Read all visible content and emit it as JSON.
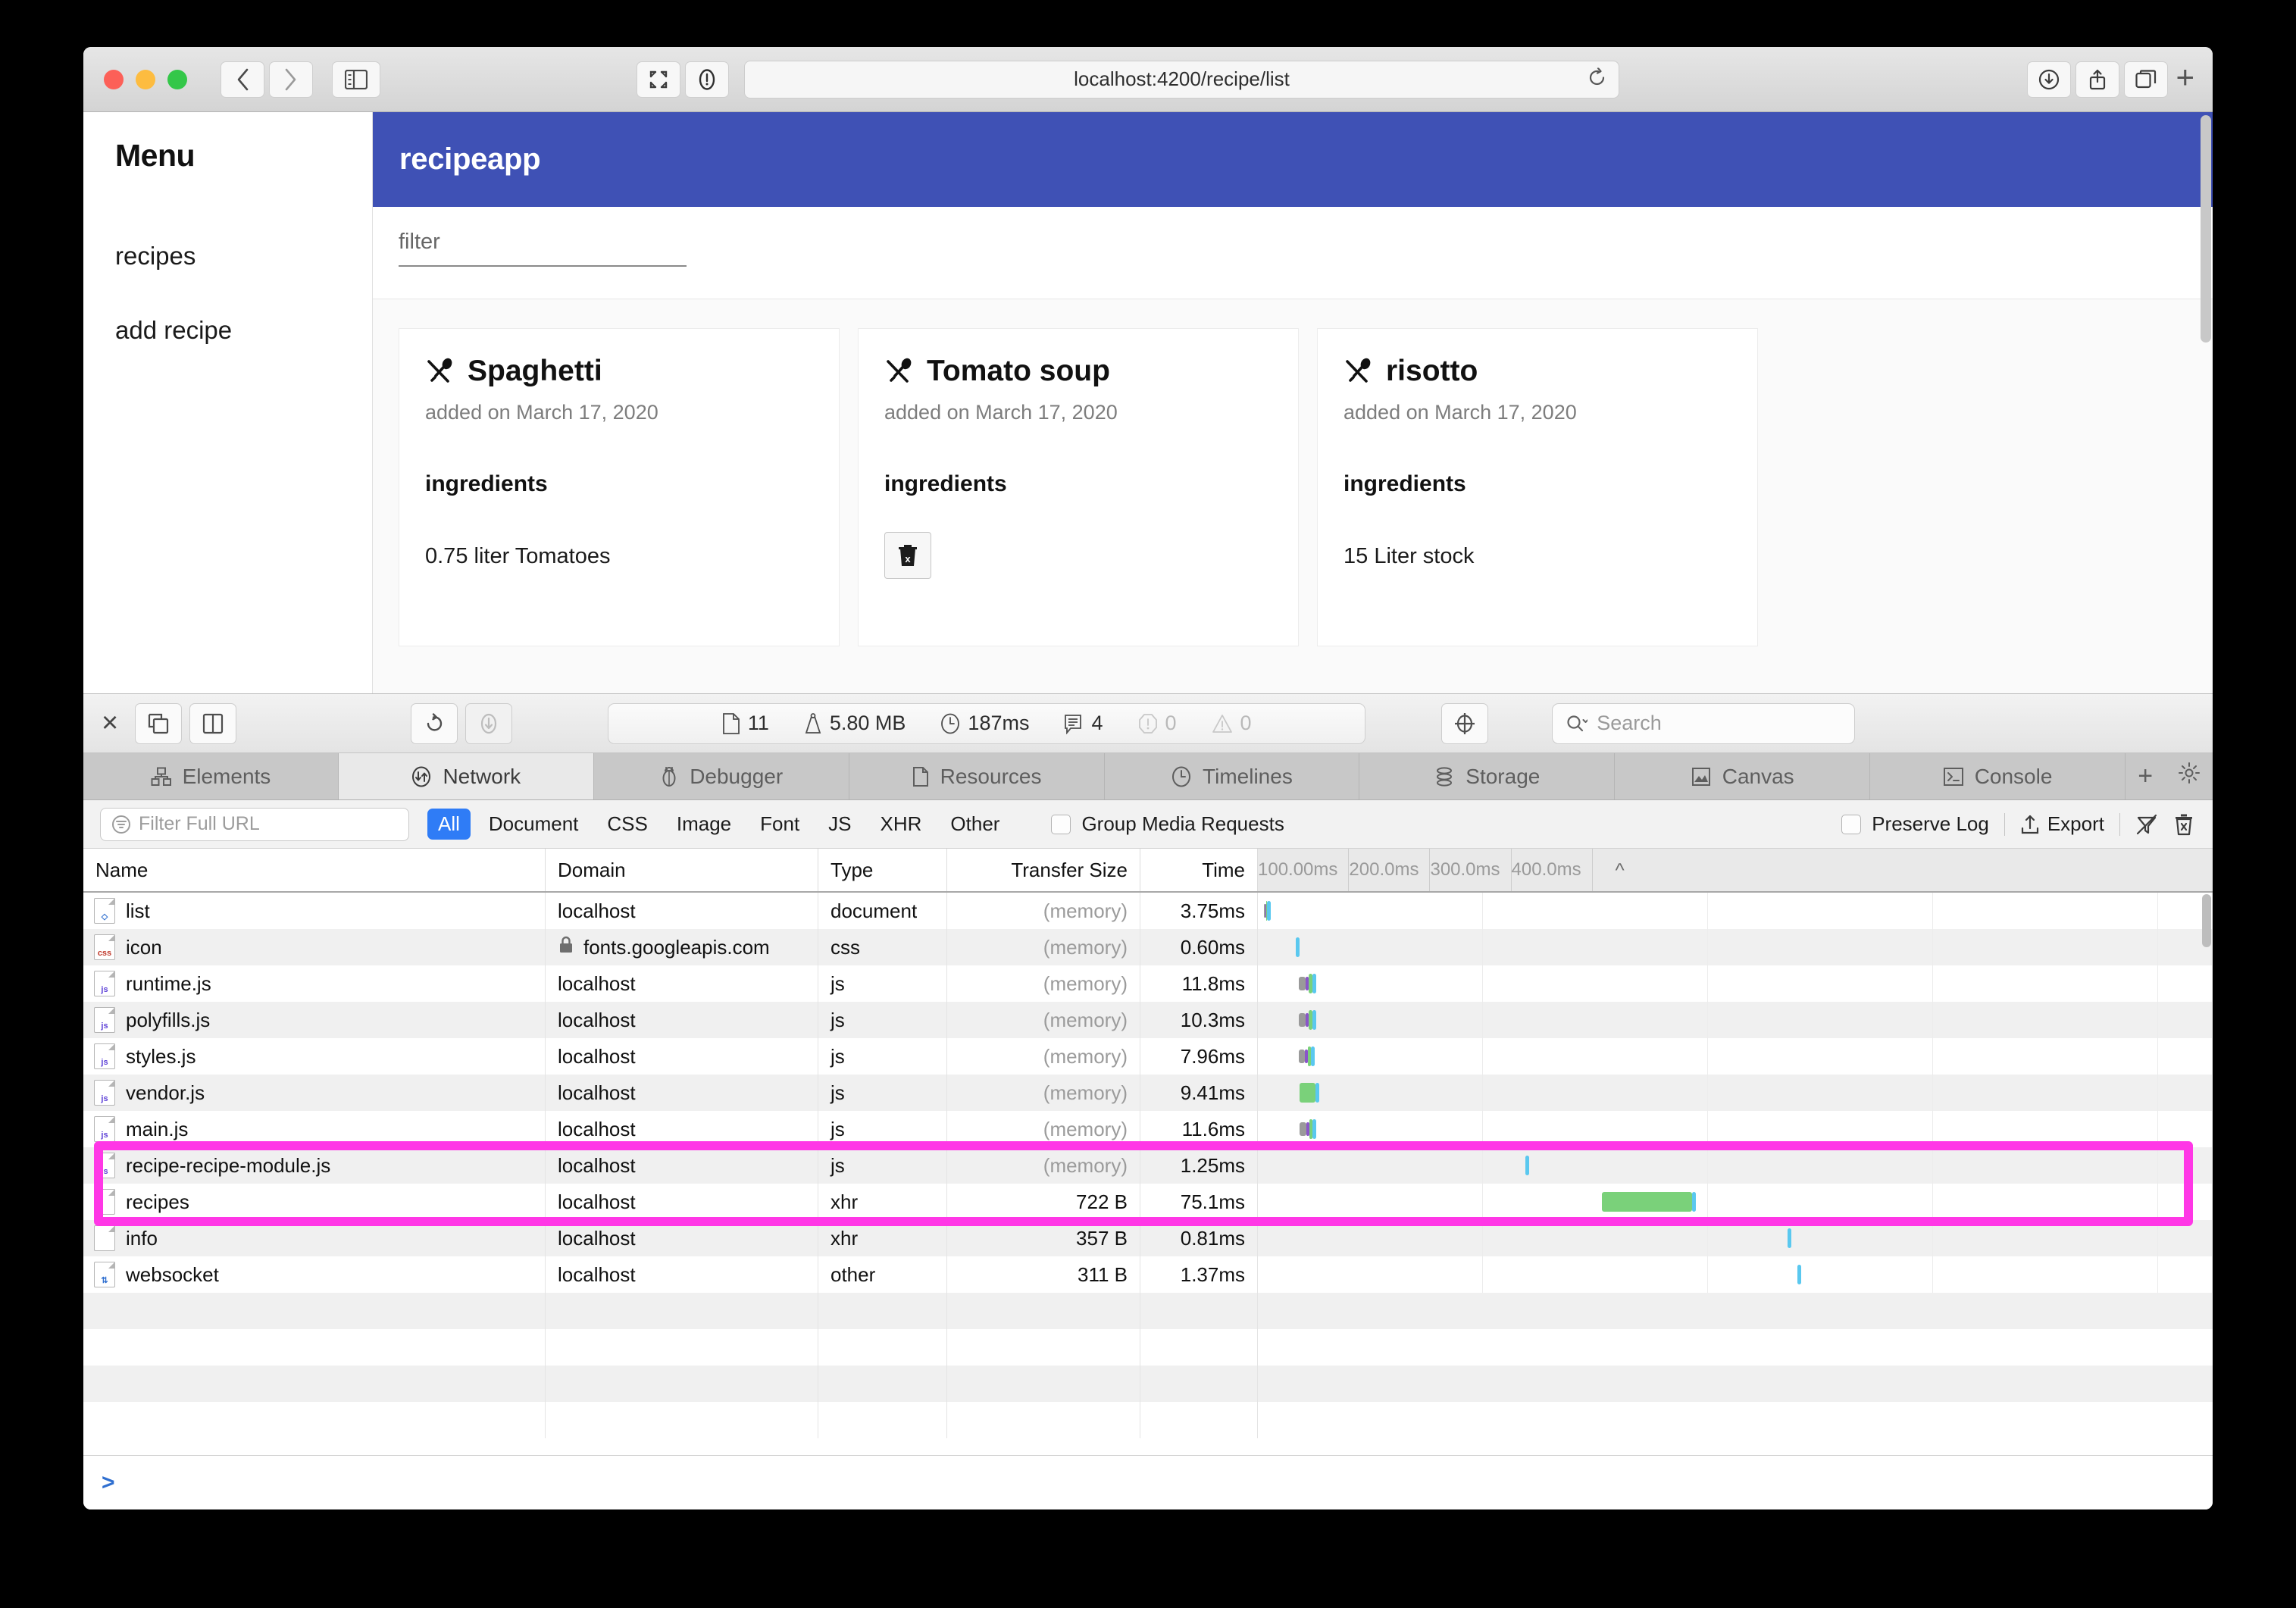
{
  "browser": {
    "url": "localhost:4200/recipe/list",
    "traffic_lights": [
      "close",
      "minimize",
      "zoom"
    ],
    "icons": {
      "back": "back-chevron-icon",
      "forward": "forward-chevron-icon",
      "sidebar": "sidebar-toggle-icon",
      "tab_overview": "tab-overview-icon",
      "reader": "reader-mode-icon",
      "reload": "reload-icon",
      "downloads": "downloads-icon",
      "share": "share-icon",
      "new_tab_overview": "tab-switcher-icon",
      "new_tab": "+"
    }
  },
  "app": {
    "sidebar": {
      "title": "Menu",
      "items": [
        {
          "label": "recipes"
        },
        {
          "label": "add recipe"
        }
      ]
    },
    "header": {
      "brand": "recipeapp",
      "color": "#3f51b5"
    },
    "filter": {
      "placeholder": "filter",
      "value": ""
    },
    "cards": [
      {
        "title": "Spaghetti",
        "subtitle": "added on March 17, 2020",
        "ingredients_label": "ingredients",
        "first_ingredient": "0.75 liter Tomatoes",
        "show_delete": false
      },
      {
        "title": "Tomato soup",
        "subtitle": "added on March 17, 2020",
        "ingredients_label": "ingredients",
        "first_ingredient": "",
        "show_delete": true
      },
      {
        "title": "risotto",
        "subtitle": "added on March 17, 2020",
        "ingredients_label": "ingredients",
        "first_ingredient": "15 Liter stock",
        "show_delete": false
      }
    ]
  },
  "devtools": {
    "toolbar": {
      "close": "×",
      "dock_undock_icon": "undock-window-icon",
      "dock_side_icon": "dock-split-icon",
      "reload_icon": "reload-icon",
      "force_reload_icon": "download-cache-icon",
      "inspect_icon": "target-inspect-icon",
      "stats": {
        "resources": "11",
        "size": "5.80 MB",
        "time": "187ms",
        "messages": "4",
        "errors": "0",
        "warnings": "0"
      },
      "search_placeholder": "Search"
    },
    "tabs": [
      {
        "label": "Elements",
        "icon": "elements-tree-icon",
        "active": false
      },
      {
        "label": "Network",
        "icon": "network-arrows-icon",
        "active": true
      },
      {
        "label": "Debugger",
        "icon": "bug-icon",
        "active": false
      },
      {
        "label": "Resources",
        "icon": "document-icon",
        "active": false
      },
      {
        "label": "Timelines",
        "icon": "clock-icon",
        "active": false
      },
      {
        "label": "Storage",
        "icon": "database-icon",
        "active": false
      },
      {
        "label": "Canvas",
        "icon": "image-icon",
        "active": false
      },
      {
        "label": "Console",
        "icon": "console-prompt-icon",
        "active": false
      }
    ],
    "tabs_extra": {
      "add": "+",
      "settings": "gear-icon"
    },
    "filterbar": {
      "url_filter_placeholder": "Filter Full URL",
      "url_filter_icon": "filter-icon",
      "chips": [
        {
          "label": "All",
          "active": true
        },
        {
          "label": "Document",
          "active": false
        },
        {
          "label": "CSS",
          "active": false
        },
        {
          "label": "Image",
          "active": false
        },
        {
          "label": "Font",
          "active": false
        },
        {
          "label": "JS",
          "active": false
        },
        {
          "label": "XHR",
          "active": false
        },
        {
          "label": "Other",
          "active": false
        }
      ],
      "group_media_label": "Group Media Requests",
      "group_media_checked": false,
      "preserve_log_label": "Preserve Log",
      "preserve_log_checked": false,
      "export_label": "Export",
      "export_icon": "export-upload-icon",
      "clear_on_load_icon": "no-clear-icon",
      "trash_icon": "clear-network-icon"
    },
    "table": {
      "columns": [
        "Name",
        "Domain",
        "Type",
        "Transfer Size",
        "Time"
      ],
      "waterfall_ticks": [
        "100.00ms",
        "200.0ms",
        "300.0ms",
        "400.0ms"
      ],
      "collapse_icon": "^",
      "rows": [
        {
          "name": "list",
          "icon": "document-file-icon",
          "domain": "localhost",
          "secure": false,
          "type": "document",
          "size": "(memory)",
          "time": "3.75ms",
          "bar": {
            "left": 0.6,
            "width": 0.4,
            "color": "multi"
          }
        },
        {
          "name": "icon",
          "icon": "css-file-icon",
          "domain": "fonts.googleapis.com",
          "secure": true,
          "type": "css",
          "size": "(memory)",
          "time": "0.60ms",
          "bar": {
            "left": 4.0,
            "width": 0.4,
            "color": "blue"
          }
        },
        {
          "name": "runtime.js",
          "icon": "js-file-icon",
          "domain": "localhost",
          "secure": false,
          "type": "js",
          "size": "(memory)",
          "time": "11.8ms",
          "bar": {
            "left": 4.3,
            "width": 1.6,
            "color": "multi"
          }
        },
        {
          "name": "polyfills.js",
          "icon": "js-file-icon",
          "domain": "localhost",
          "secure": false,
          "type": "js",
          "size": "(memory)",
          "time": "10.3ms",
          "bar": {
            "left": 4.3,
            "width": 1.6,
            "color": "multi"
          }
        },
        {
          "name": "styles.js",
          "icon": "js-file-icon",
          "domain": "localhost",
          "secure": false,
          "type": "js",
          "size": "(memory)",
          "time": "7.96ms",
          "bar": {
            "left": 4.3,
            "width": 1.4,
            "color": "multi"
          }
        },
        {
          "name": "vendor.js",
          "icon": "js-file-icon",
          "domain": "localhost",
          "secure": false,
          "type": "js",
          "size": "(memory)",
          "time": "9.41ms",
          "bar": {
            "left": 4.4,
            "width": 1.6,
            "color": "green"
          }
        },
        {
          "name": "main.js",
          "icon": "js-file-icon",
          "domain": "localhost",
          "secure": false,
          "type": "js",
          "size": "(memory)",
          "time": "11.6ms",
          "bar": {
            "left": 4.4,
            "width": 1.5,
            "color": "multi"
          }
        },
        {
          "name": "recipe-recipe-module.js",
          "icon": "js-file-icon",
          "domain": "localhost",
          "secure": false,
          "type": "js",
          "size": "(memory)",
          "time": "1.25ms",
          "bar": {
            "left": 28.0,
            "width": 0.5,
            "color": "blue"
          }
        },
        {
          "name": "recipes",
          "icon": "xhr-file-icon",
          "domain": "localhost",
          "secure": false,
          "type": "xhr",
          "size": "722 B",
          "time": "75.1ms",
          "bar": {
            "left": 36.0,
            "width": 9.5,
            "color": "green"
          }
        },
        {
          "name": "info",
          "icon": "xhr-file-icon",
          "domain": "localhost",
          "secure": false,
          "type": "xhr",
          "size": "357 B",
          "time": "0.81ms",
          "bar": {
            "left": 55.5,
            "width": 0.4,
            "color": "blue"
          }
        },
        {
          "name": "websocket",
          "icon": "websocket-icon",
          "domain": "localhost",
          "secure": false,
          "type": "other",
          "size": "311 B",
          "time": "1.37ms",
          "bar": {
            "left": 56.5,
            "width": 0.4,
            "color": "blue"
          }
        }
      ],
      "highlighted_rows": [
        "recipe-recipe-module.js",
        "recipes"
      ],
      "highlight_color": "#ff37e6"
    },
    "console_prompt": ">"
  }
}
